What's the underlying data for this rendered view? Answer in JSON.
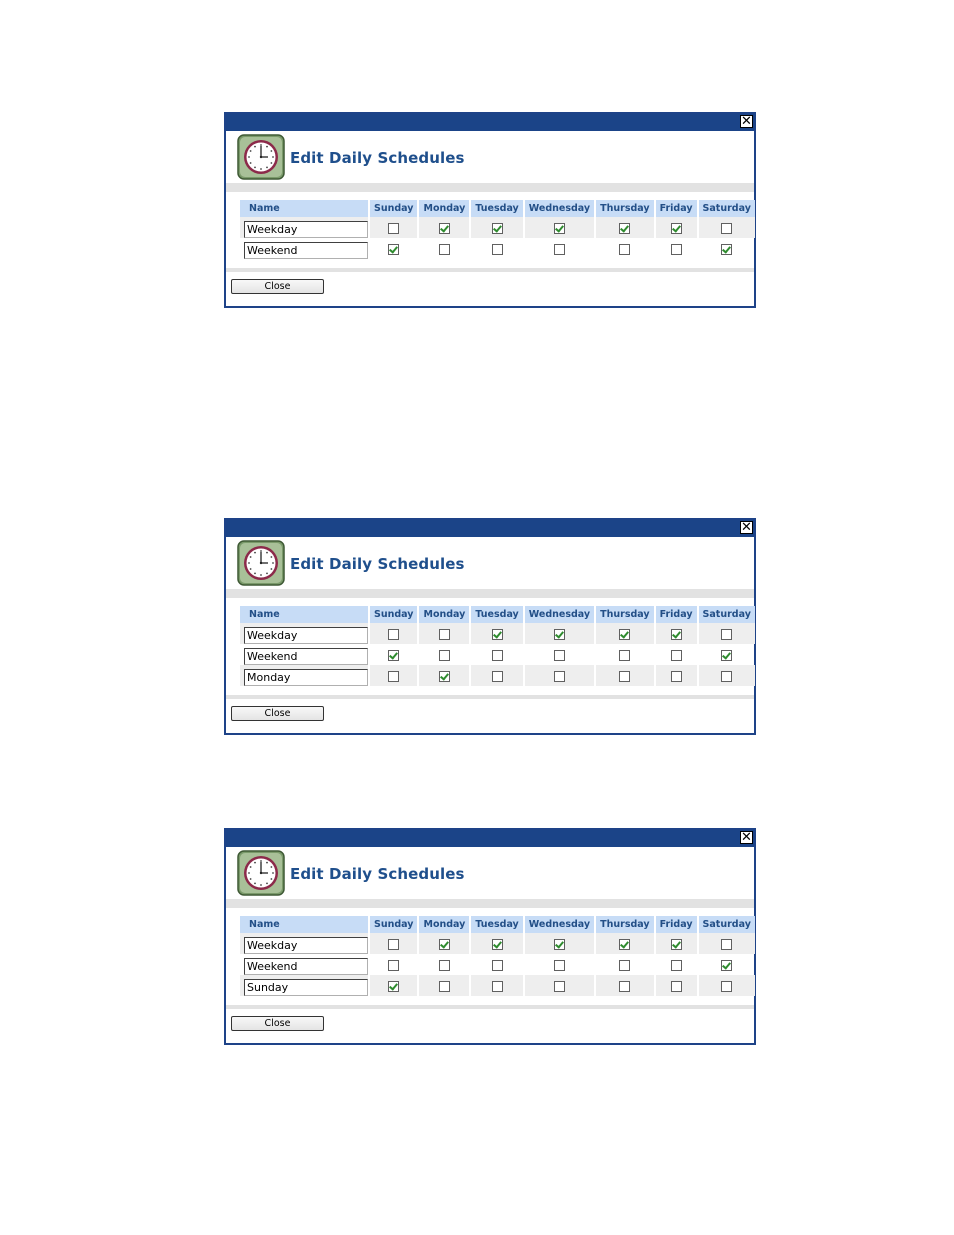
{
  "dialog_title": "Edit Daily Schedules",
  "close_button_label": "Close",
  "close_x": "✕",
  "columns": [
    "Name",
    "Sunday",
    "Monday",
    "Tuesday",
    "Wednesday",
    "Thursday",
    "Friday",
    "Saturday"
  ],
  "dialogs": [
    {
      "rows": [
        {
          "name": "Weekday",
          "days": [
            false,
            true,
            true,
            true,
            true,
            true,
            false
          ]
        },
        {
          "name": "Weekend",
          "days": [
            true,
            false,
            false,
            false,
            false,
            false,
            true
          ]
        }
      ]
    },
    {
      "rows": [
        {
          "name": "Weekday",
          "days": [
            false,
            false,
            true,
            true,
            true,
            true,
            false
          ]
        },
        {
          "name": "Weekend",
          "days": [
            true,
            false,
            false,
            false,
            false,
            false,
            true
          ]
        },
        {
          "name": "Monday",
          "days": [
            false,
            true,
            false,
            false,
            false,
            false,
            false
          ]
        }
      ]
    },
    {
      "rows": [
        {
          "name": "Weekday",
          "days": [
            false,
            true,
            true,
            true,
            true,
            true,
            false
          ]
        },
        {
          "name": "Weekend",
          "days": [
            false,
            false,
            false,
            false,
            false,
            false,
            true
          ]
        },
        {
          "name": "Sunday",
          "days": [
            true,
            false,
            false,
            false,
            false,
            false,
            false
          ]
        }
      ]
    }
  ]
}
